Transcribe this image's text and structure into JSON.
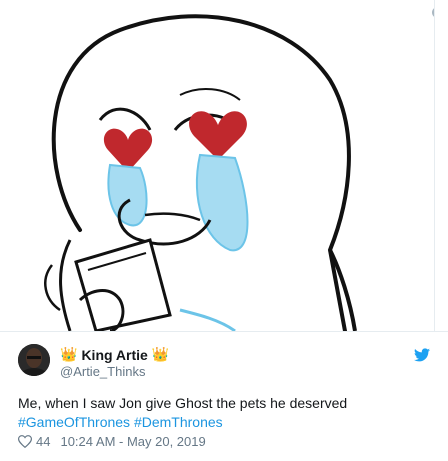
{
  "colors": {
    "link": "#1b95e0",
    "muted": "#657786",
    "text": "#14171a",
    "twitter_blue": "#1da1f2"
  },
  "media": {
    "info_icon": "i"
  },
  "tweet": {
    "author_name": "King Artie",
    "crown_left": "👑",
    "crown_right": "👑",
    "handle": "@Artie_Thinks",
    "text": "Me, when I saw Jon give Ghost the pets he deserved",
    "hashtags": [
      "#GameOfThrones",
      "#DemThrones"
    ],
    "likes": "44",
    "timestamp": "10:24 AM - May 20, 2019"
  },
  "icons": {
    "brand": "twitter-bird-icon",
    "likes": "heart-outline-icon",
    "info": "info-icon"
  }
}
